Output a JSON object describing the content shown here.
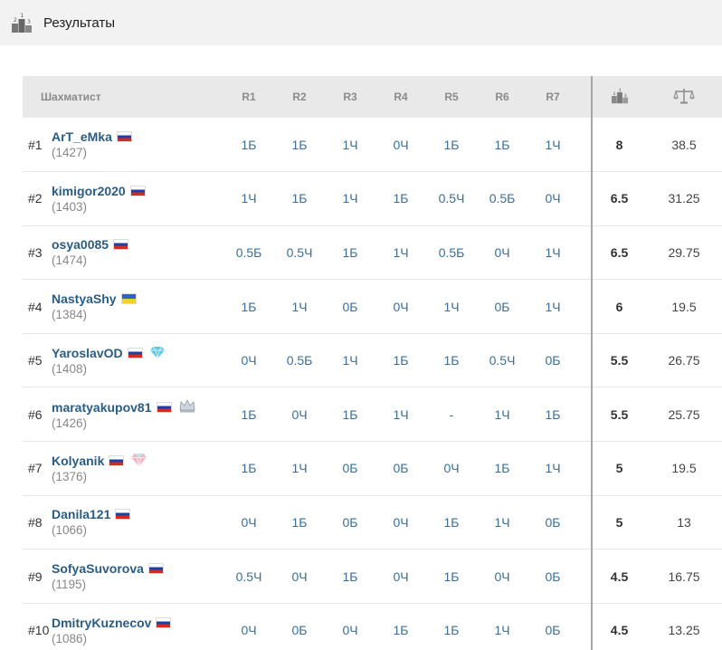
{
  "header": {
    "title": "Результаты",
    "icon": "podium-icon"
  },
  "table": {
    "columns": {
      "player": "Шахматист",
      "rounds": [
        "R1",
        "R2",
        "R3",
        "R4",
        "R5",
        "R6",
        "R7"
      ],
      "points_icon": "podium-icon",
      "tiebreak_icon": "scales-icon"
    },
    "rows": [
      {
        "rank": "#1",
        "name": "ArT_eMka",
        "rating": "(1427)",
        "flag": "ru",
        "badge": "",
        "results": [
          "1Б",
          "1Б",
          "1Ч",
          "0Ч",
          "1Б",
          "1Б",
          "1Ч"
        ],
        "points": "8",
        "tiebreak": "38.5"
      },
      {
        "rank": "#2",
        "name": "kimigor2020",
        "rating": "(1403)",
        "flag": "ru",
        "badge": "",
        "results": [
          "1Ч",
          "1Б",
          "1Ч",
          "1Б",
          "0.5Ч",
          "0.5Б",
          "0Ч"
        ],
        "points": "6.5",
        "tiebreak": "31.25"
      },
      {
        "rank": "#3",
        "name": "osya0085",
        "rating": "(1474)",
        "flag": "ru",
        "badge": "",
        "results": [
          "0.5Б",
          "0.5Ч",
          "1Б",
          "1Ч",
          "0.5Б",
          "0Ч",
          "1Ч"
        ],
        "points": "6.5",
        "tiebreak": "29.75"
      },
      {
        "rank": "#4",
        "name": "NastyaShy",
        "rating": "(1384)",
        "flag": "ua",
        "badge": "",
        "results": [
          "1Б",
          "1Ч",
          "0Б",
          "0Ч",
          "1Ч",
          "0Б",
          "1Ч"
        ],
        "points": "6",
        "tiebreak": "19.5"
      },
      {
        "rank": "#5",
        "name": "YaroslavOD",
        "rating": "(1408)",
        "flag": "ru",
        "badge": "diamond-icon",
        "results": [
          "0Ч",
          "0.5Б",
          "1Ч",
          "1Б",
          "1Б",
          "0.5Ч",
          "0Б"
        ],
        "points": "5.5",
        "tiebreak": "26.75"
      },
      {
        "rank": "#6",
        "name": "maratyakupov81",
        "rating": "(1426)",
        "flag": "ru",
        "badge": "crown-icon",
        "results": [
          "1Б",
          "0Ч",
          "1Б",
          "1Ч",
          "-",
          "1Ч",
          "1Б"
        ],
        "points": "5.5",
        "tiebreak": "25.75"
      },
      {
        "rank": "#7",
        "name": "Kolyanik",
        "rating": "(1376)",
        "flag": "ru",
        "badge": "gem-icon",
        "results": [
          "1Б",
          "1Ч",
          "0Б",
          "0Б",
          "0Ч",
          "1Б",
          "1Ч"
        ],
        "points": "5",
        "tiebreak": "19.5"
      },
      {
        "rank": "#8",
        "name": "Danila121",
        "rating": "(1066)",
        "flag": "ru",
        "badge": "",
        "results": [
          "0Ч",
          "1Б",
          "0Б",
          "0Ч",
          "1Б",
          "1Ч",
          "0Б"
        ],
        "points": "5",
        "tiebreak": "13"
      },
      {
        "rank": "#9",
        "name": "SofyaSuvorova",
        "rating": "(1195)",
        "flag": "ru",
        "badge": "",
        "results": [
          "0.5Ч",
          "0Ч",
          "1Б",
          "0Ч",
          "1Б",
          "0Ч",
          "0Б"
        ],
        "points": "4.5",
        "tiebreak": "16.75"
      },
      {
        "rank": "#10",
        "name": "DmitryKuznecov",
        "rating": "(1086)",
        "flag": "ru",
        "badge": "",
        "results": [
          "0Ч",
          "0Б",
          "0Ч",
          "1Б",
          "1Б",
          "1Ч",
          "0Б"
        ],
        "points": "4.5",
        "tiebreak": "13.25"
      }
    ]
  }
}
